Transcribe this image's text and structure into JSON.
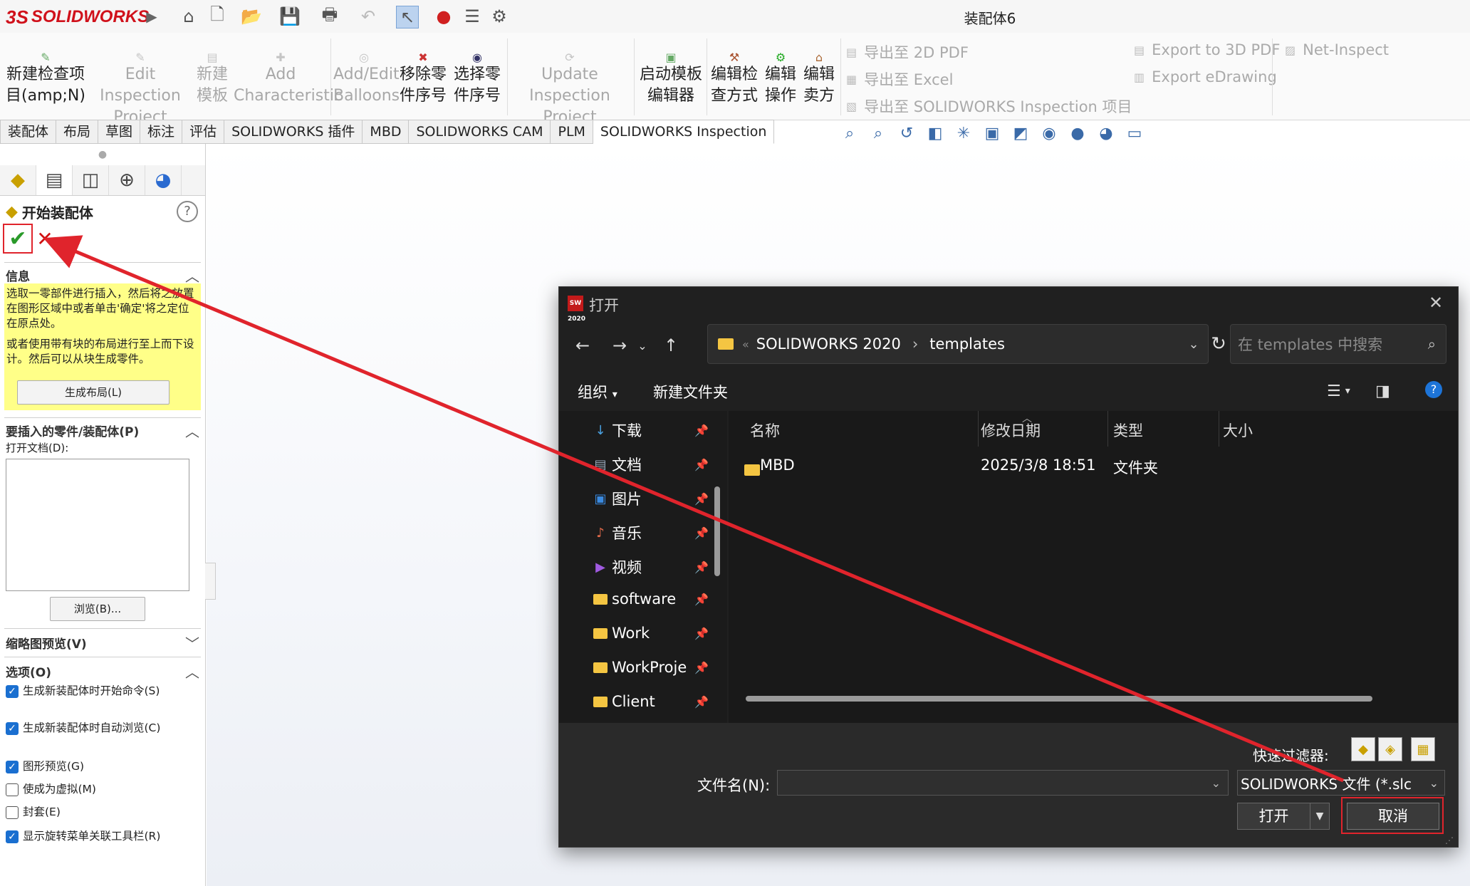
{
  "app": {
    "logo_text": "SOLIDWORKS",
    "logo_prefix": "3S",
    "document_title": "装配体6"
  },
  "quick_access": [
    "home-icon",
    "new-icon",
    "open-icon",
    "save-icon",
    "print-icon",
    "undo-icon",
    "select-icon",
    "traffic-light-icon",
    "options-list-icon",
    "gear-icon"
  ],
  "ribbon": {
    "buttons": [
      {
        "label1": "新建检查项",
        "label2": "目(amp;N)",
        "enabled": true
      },
      {
        "label1": "Edit Inspection",
        "label2": "Project",
        "enabled": false
      },
      {
        "label1": "新建",
        "label2": "模板",
        "enabled": false
      },
      {
        "label1": "Add",
        "label2": "Characteristic",
        "enabled": false
      },
      {
        "label1": "Add/Edit",
        "label2": "Balloons",
        "enabled": false
      },
      {
        "label1": "移除零",
        "label2": "件序号",
        "enabled": true
      },
      {
        "label1": "选择零",
        "label2": "件序号",
        "enabled": true
      },
      {
        "label1": "Update Inspection",
        "label2": "Project",
        "enabled": false
      },
      {
        "label1": "启动模板",
        "label2": "编辑器",
        "enabled": true
      },
      {
        "label1": "编辑检",
        "label2": "查方式",
        "enabled": true
      },
      {
        "label1": "编辑",
        "label2": "操作",
        "enabled": true
      },
      {
        "label1": "编辑",
        "label2": "卖方",
        "enabled": true
      }
    ],
    "export_2d_pdf": "导出至 2D PDF",
    "export_excel": "导出至 Excel",
    "export_inspection": "导出至 SOLIDWORKS Inspection 项目",
    "export_3d_pdf": "Export to 3D PDF",
    "export_edrawing": "Export eDrawing",
    "net_inspect": "Net-Inspect"
  },
  "tabs": [
    "装配体",
    "布局",
    "草图",
    "标注",
    "评估",
    "SOLIDWORKS 插件",
    "MBD",
    "SOLIDWORKS CAM",
    "PLM",
    "SOLIDWORKS Inspection"
  ],
  "active_tab": "SOLIDWORKS Inspection",
  "property_manager": {
    "title": "开始装配体",
    "info_header": "信息",
    "info_text_1": "选取一零部件进行插入，然后将之放置在图形区域中或者单击'确定'将之定位在原点处。",
    "info_text_2": "或者使用带有块的布局进行至上而下设计。然后可以从块生成零件。",
    "make_layout_button": "生成布局(L)",
    "part_section_header": "要插入的零件/装配体(P)",
    "open_documents_label": "打开文档(D):",
    "browse_button": "浏览(B)...",
    "thumbnail_header": "缩略图预览(V)",
    "options_header": "选项(O)",
    "options": [
      {
        "label": "生成新装配体时开始命令(S)",
        "checked": true
      },
      {
        "label": "生成新装配体时自动浏览(C)",
        "checked": true
      },
      {
        "label": "图形预览(G)",
        "checked": true
      },
      {
        "label": "使成为虚拟(M)",
        "checked": false
      },
      {
        "label": "封套(E)",
        "checked": false
      },
      {
        "label": "显示旋转菜单关联工具栏(R)",
        "checked": true
      }
    ]
  },
  "dialog": {
    "title": "打开",
    "app_icon_text": "SW 2020",
    "address": {
      "segment1": "SOLIDWORKS 2020",
      "segment2": "templates"
    },
    "search_placeholder": "在 templates 中搜索",
    "organize": "组织",
    "new_folder": "新建文件夹",
    "nav_items": [
      {
        "label": "下载",
        "icon": "download-icon"
      },
      {
        "label": "文档",
        "icon": "documents-icon"
      },
      {
        "label": "图片",
        "icon": "pictures-icon"
      },
      {
        "label": "音乐",
        "icon": "music-icon"
      },
      {
        "label": "视频",
        "icon": "video-icon"
      },
      {
        "label": "software",
        "icon": "folder-icon"
      },
      {
        "label": "Work",
        "icon": "folder-icon"
      },
      {
        "label": "WorkProje",
        "icon": "folder-icon"
      },
      {
        "label": "Client",
        "icon": "folder-icon"
      }
    ],
    "columns": {
      "name": "名称",
      "modified": "修改日期",
      "type": "类型",
      "size": "大小"
    },
    "files": [
      {
        "name": "MBD",
        "modified": "2025/3/8 18:51",
        "type": "文件夹",
        "size": ""
      }
    ],
    "quick_filter_label": "快速过滤器:",
    "filename_label": "文件名(N):",
    "filename_value": "",
    "file_type": "SOLIDWORKS 文件 (*.slc",
    "open_button": "打开",
    "cancel_button": "取消"
  },
  "colors": {
    "accent_red": "#e0242c",
    "info_yellow": "#ffff88",
    "dialog_bg": "#202020",
    "folder_yellow": "#f4c542"
  }
}
